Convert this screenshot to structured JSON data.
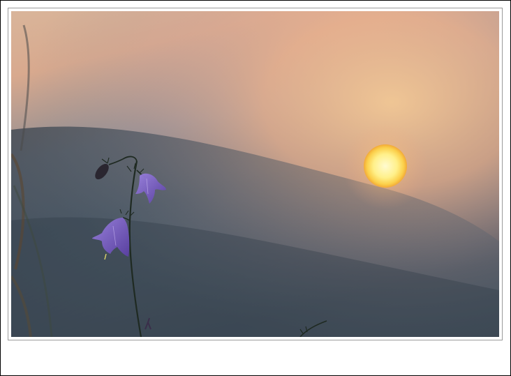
{
  "image": {
    "subject": "harebell-flowers-at-sunset",
    "colors": {
      "sky_warm": "#f3c79a",
      "sky_peach": "#e9a98a",
      "haze_mid": "#7f8a96",
      "haze_dark": "#3f4b57",
      "sun_core": "#fff6b0",
      "sun_edge": "#f5b83a",
      "petal": "#7b5fc4",
      "stem": "#1f2a22"
    }
  }
}
